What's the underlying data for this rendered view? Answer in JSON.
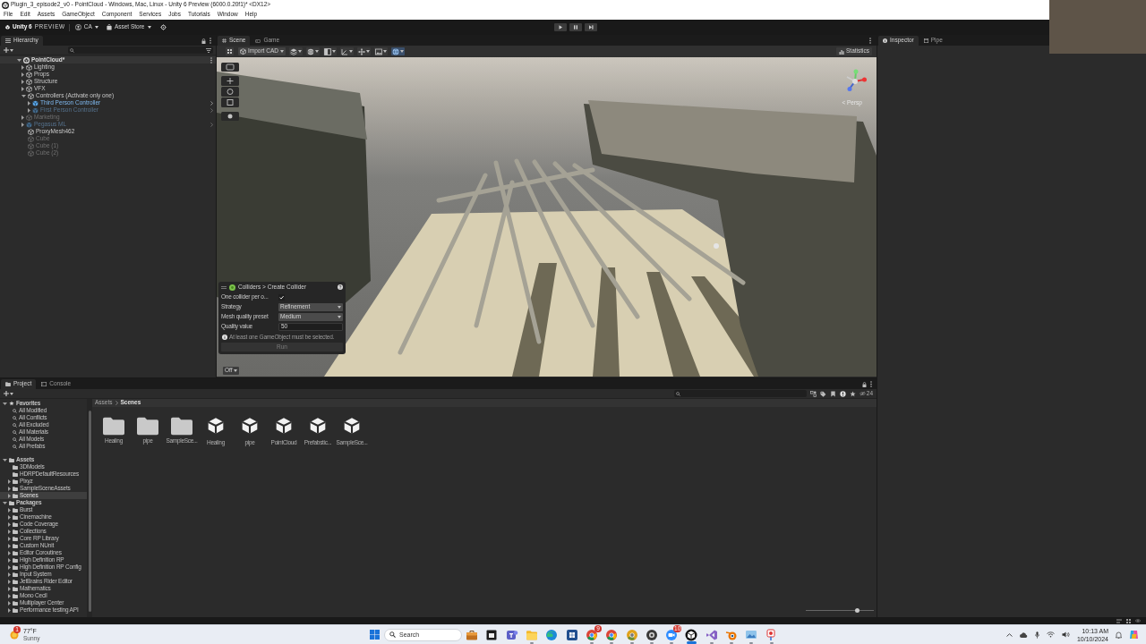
{
  "window": {
    "title": "Plugin_3_episode2_v0 - PointCloud - Windows, Mac, Linux - Unity 6 Preview (6000.0.20f1)* <DX12>"
  },
  "menu": [
    "File",
    "Edit",
    "Assets",
    "GameObject",
    "Component",
    "Services",
    "Jobs",
    "Tutorials",
    "Window",
    "Help"
  ],
  "toolbar": {
    "product": "Unity 6",
    "edition": "PREVIEW",
    "account": "CA",
    "store": "Asset Store"
  },
  "hierarchy": {
    "tab": {
      "label": "Hierarchy",
      "selected": true
    },
    "scene": {
      "label": "PointCloud*",
      "expanded": true,
      "children": [
        {
          "label": "Lighting",
          "kind": "object",
          "expanded": false,
          "disabled": false
        },
        {
          "label": "Props",
          "kind": "object",
          "expanded": false,
          "disabled": false
        },
        {
          "label": "Structure",
          "kind": "object",
          "expanded": false,
          "disabled": false
        },
        {
          "label": "VFX",
          "kind": "object",
          "expanded": false,
          "disabled": false
        },
        {
          "label": "Controllers (Activate only one)",
          "kind": "object",
          "expanded": true,
          "disabled": false,
          "children": [
            {
              "label": "Third Person Controller",
              "kind": "prefab",
              "expanded": false,
              "disabled": false
            },
            {
              "label": "First Person Controller",
              "kind": "prefab",
              "expanded": false,
              "disabled": true
            }
          ]
        },
        {
          "label": "Marketing",
          "kind": "object",
          "expanded": false,
          "disabled": true
        },
        {
          "label": "Pegasus ML",
          "kind": "prefab",
          "expanded": false,
          "disabled": true
        },
        {
          "label": "ProxyMesh462",
          "kind": "object",
          "disabled": false
        },
        {
          "label": "Cube",
          "kind": "object",
          "disabled": true
        },
        {
          "label": "Cube (1)",
          "kind": "object",
          "disabled": true
        },
        {
          "label": "Cube (2)",
          "kind": "object",
          "disabled": true
        }
      ]
    }
  },
  "scene_view": {
    "tabs": [
      {
        "label": "Scene",
        "selected": true
      },
      {
        "label": "Game",
        "selected": false
      }
    ],
    "import_button": "Import CAD",
    "statistics_button": "Statistics",
    "camera_label": "< Persp",
    "collider_overlay": {
      "title": "Colliders > Create Collider",
      "fields": [
        {
          "kind": "checkbox",
          "label": "One collider per o...",
          "checked": true
        },
        {
          "kind": "dropdown",
          "label": "Strategy",
          "value": "Refinement"
        },
        {
          "kind": "dropdown",
          "label": "Mesh quality preset",
          "value": "Medium"
        },
        {
          "kind": "number",
          "label": "Quality value",
          "value": "50"
        }
      ],
      "message": "At least one GameObject must be selected.",
      "run_button": {
        "label": "Run",
        "disabled": true
      }
    },
    "view_button": "Off"
  },
  "inspector": {
    "tabs": [
      {
        "label": "Inspector",
        "selected": true
      },
      {
        "label": "Pipe",
        "selected": false
      }
    ]
  },
  "project": {
    "tabs": [
      {
        "label": "Project",
        "selected": true
      },
      {
        "label": "Console",
        "selected": false
      }
    ],
    "tree": [
      {
        "label": "Favorites",
        "kind": "favorites",
        "expanded": true,
        "selected": false,
        "children": [
          {
            "label": "All Modified",
            "kind": "search",
            "selected": false
          },
          {
            "label": "All Conflicts",
            "kind": "search",
            "selected": false
          },
          {
            "label": "All Excluded",
            "kind": "search",
            "selected": false
          },
          {
            "label": "All Materials",
            "kind": "search",
            "selected": false
          },
          {
            "label": "All Models",
            "kind": "search",
            "selected": false
          },
          {
            "label": "All Prefabs",
            "kind": "search",
            "selected": false
          }
        ]
      },
      {
        "label": "Assets",
        "kind": "folder",
        "expanded": true,
        "selected": false,
        "children": [
          {
            "label": "3DModels",
            "kind": "folder",
            "selected": false
          },
          {
            "label": "HDRPDefaultResources",
            "kind": "folder",
            "selected": false
          },
          {
            "label": "Pixyz",
            "kind": "folder",
            "expanded": false,
            "selected": false
          },
          {
            "label": "SampleSceneAssets",
            "kind": "folder",
            "expanded": false,
            "selected": false
          },
          {
            "label": "Scenes",
            "kind": "folder",
            "expanded": false,
            "selected": true
          }
        ]
      },
      {
        "label": "Packages",
        "kind": "folder",
        "expanded": true,
        "selected": false,
        "children": [
          {
            "label": "Burst",
            "kind": "folder",
            "expanded": false,
            "selected": false
          },
          {
            "label": "Cinemachine",
            "kind": "folder",
            "expanded": false,
            "selected": false
          },
          {
            "label": "Code Coverage",
            "kind": "folder",
            "expanded": false,
            "selected": false
          },
          {
            "label": "Collections",
            "kind": "folder",
            "expanded": false,
            "selected": false
          },
          {
            "label": "Core RP Library",
            "kind": "folder",
            "expanded": false,
            "selected": false
          },
          {
            "label": "Custom NUnit",
            "kind": "folder",
            "expanded": false,
            "selected": false
          },
          {
            "label": "Editor Coroutines",
            "kind": "folder",
            "expanded": false,
            "selected": false
          },
          {
            "label": "High Definition RP",
            "kind": "folder",
            "expanded": false,
            "selected": false
          },
          {
            "label": "High Definition RP Config",
            "kind": "folder",
            "expanded": false,
            "selected": false
          },
          {
            "label": "Input System",
            "kind": "folder",
            "expanded": false,
            "selected": false
          },
          {
            "label": "JetBrains Rider Editor",
            "kind": "folder",
            "expanded": false,
            "selected": false
          },
          {
            "label": "Mathematics",
            "kind": "folder",
            "expanded": false,
            "selected": false
          },
          {
            "label": "Mono Cecil",
            "kind": "folder",
            "expanded": false,
            "selected": false
          },
          {
            "label": "Multiplayer Center",
            "kind": "folder",
            "expanded": false,
            "selected": false
          },
          {
            "label": "Performance testing API",
            "kind": "folder",
            "expanded": false,
            "selected": false
          }
        ]
      }
    ],
    "breadcrumb": [
      "Assets",
      "Scenes"
    ],
    "hidden_count": "24",
    "assets": [
      {
        "label": "Healing",
        "kind": "folder"
      },
      {
        "label": "pipe",
        "kind": "folder"
      },
      {
        "label": "SampleSce...",
        "kind": "folder"
      },
      {
        "label": "Healing",
        "kind": "scene"
      },
      {
        "label": "pipe",
        "kind": "scene"
      },
      {
        "label": "PointCloud",
        "kind": "scene"
      },
      {
        "label": "Prefabstic...",
        "kind": "scene"
      },
      {
        "label": "SampleSce...",
        "kind": "scene"
      }
    ],
    "icon_size": {
      "level": 0.77
    }
  },
  "taskbar": {
    "weather": {
      "temperature": "77°F",
      "condition": "Sunny",
      "badge": "1"
    },
    "search": {
      "placeholder": "Search"
    },
    "apps": [
      {
        "running": false
      },
      {
        "running": false
      },
      {
        "running": false
      },
      {
        "running": true,
        "focused": false
      },
      {
        "running": false
      },
      {
        "running": false
      },
      {
        "running": true,
        "focused": false,
        "badge": "9"
      },
      {
        "running": true,
        "focused": false
      },
      {
        "running": true,
        "focused": false
      },
      {
        "running": true,
        "focused": false
      },
      {
        "running": true,
        "focused": false,
        "badge": "10"
      },
      {
        "running": true,
        "focused": true
      },
      {
        "running": true,
        "focused": false
      },
      {
        "running": true,
        "focused": false
      },
      {
        "running": true,
        "focused": false
      },
      {
        "running": true,
        "focused": false
      }
    ],
    "clock": {
      "time": "10:13 AM",
      "date": "10/10/2024"
    }
  }
}
